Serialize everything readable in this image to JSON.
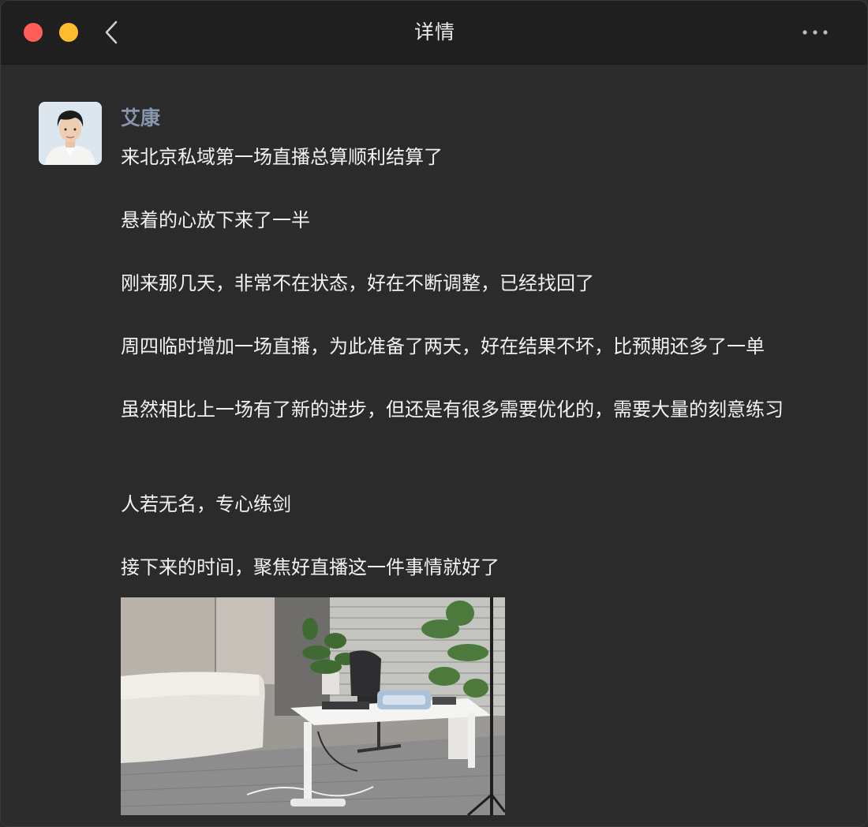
{
  "window": {
    "title": "详情"
  },
  "icons": {
    "back": "chevron-left-icon",
    "more": "more-dots-icon"
  },
  "post": {
    "author": "艾康",
    "paragraphs": [
      "来北京私域第一场直播总算顺利结算了",
      "悬着的心放下来了一半",
      "刚来那几天，非常不在状态，好在不断调整，已经找回了",
      "周四临时增加一场直播，为此准备了两天，好在结果不坏，比预期还多了一单",
      "虽然相比上一场有了新的进步，但还是有很多需要优化的，需要大量的刻意练习",
      "人若无名，专心练剑",
      "接下来的时间，聚焦好直播这一件事情就好了"
    ]
  },
  "colors": {
    "background": "#2b2b2b",
    "titlebar": "#1f1f1f",
    "author_name": "#8797b0",
    "text": "#f2f2f2",
    "close_button": "#ff5f57",
    "minimize_button": "#febc2e"
  }
}
